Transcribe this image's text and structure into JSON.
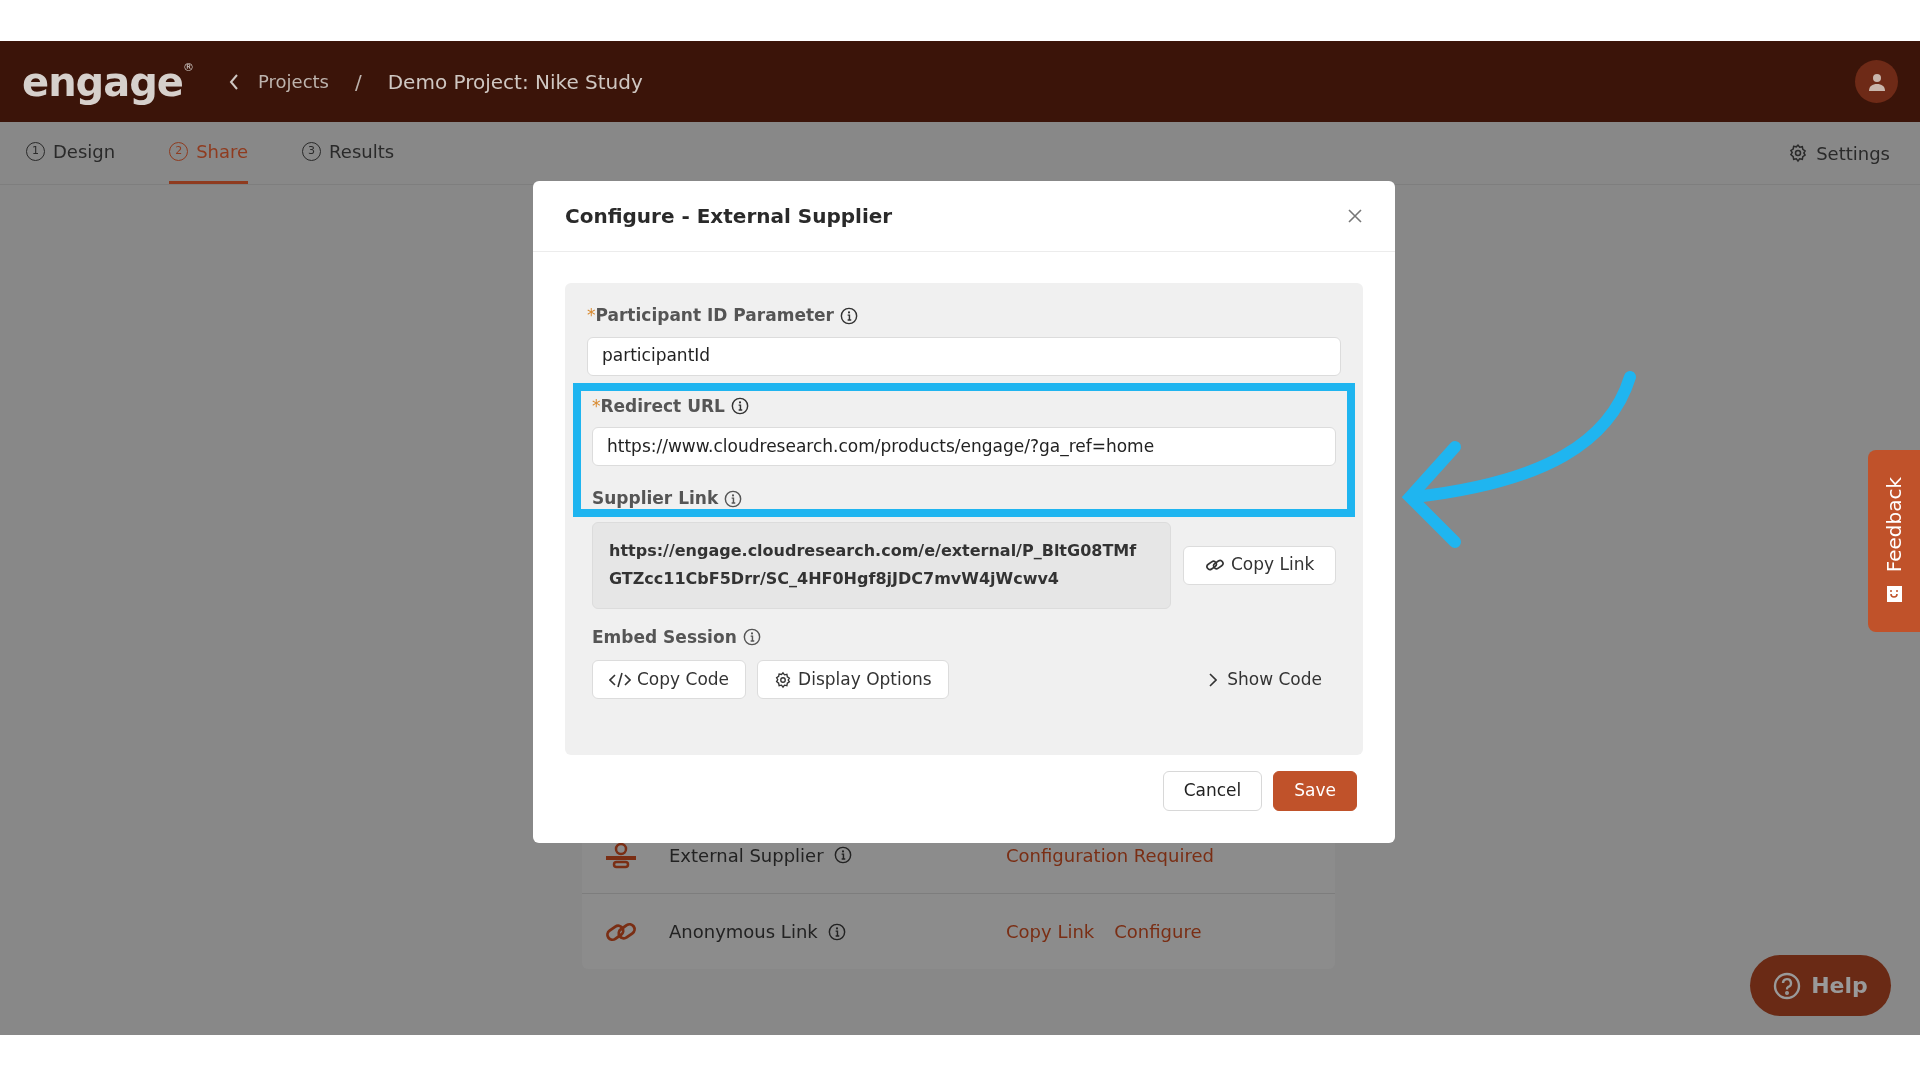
{
  "header": {
    "logo": "engage",
    "logo_mark": "®",
    "breadcrumbs": [
      {
        "label": "Projects"
      },
      {
        "label": "Demo Project: Nike Study"
      }
    ],
    "separator": "/"
  },
  "tabs": [
    {
      "number": "1",
      "label": "Design",
      "selected": false
    },
    {
      "number": "2",
      "label": "Share",
      "selected": true
    },
    {
      "number": "3",
      "label": "Results",
      "selected": false
    }
  ],
  "settings": "Settings",
  "share_list": [
    {
      "kind": "supplier",
      "label": "External Supplier",
      "actions": [
        "Configuration Required"
      ]
    },
    {
      "kind": "link",
      "label": "Anonymous Link",
      "actions": [
        "Copy Link",
        "Configure"
      ]
    }
  ],
  "dialog": {
    "title": "Configure - External Supplier",
    "fields": [
      {
        "required_mark": "*",
        "label": "Participant ID Parameter",
        "value": "participantId",
        "highlighted": false
      },
      {
        "required_mark": "*",
        "label": "Redirect URL",
        "value": "https://www.cloudresearch.com/products/engage/?ga_ref=home",
        "highlighted": true
      }
    ],
    "supplier_link": {
      "label": "Supplier Link",
      "value": "https://engage.cloudresearch.com/e/external/P_BltG08TMfGTZcc11CbF5Drr/SC_4HF0Hgf8jJDC7mvW4jWcwv4",
      "button": "Copy Link"
    },
    "embed": {
      "label": "Embed Session",
      "buttons": [
        {
          "kind": "code",
          "label": "Copy Code"
        },
        {
          "kind": "gear",
          "label": "Display Options"
        }
      ],
      "toggle": "Show Code"
    },
    "buttons": [
      {
        "kind": "secondary",
        "label": "Cancel"
      },
      {
        "kind": "primary",
        "label": "Save"
      }
    ]
  },
  "feedback": "Feedback",
  "help": "Help"
}
